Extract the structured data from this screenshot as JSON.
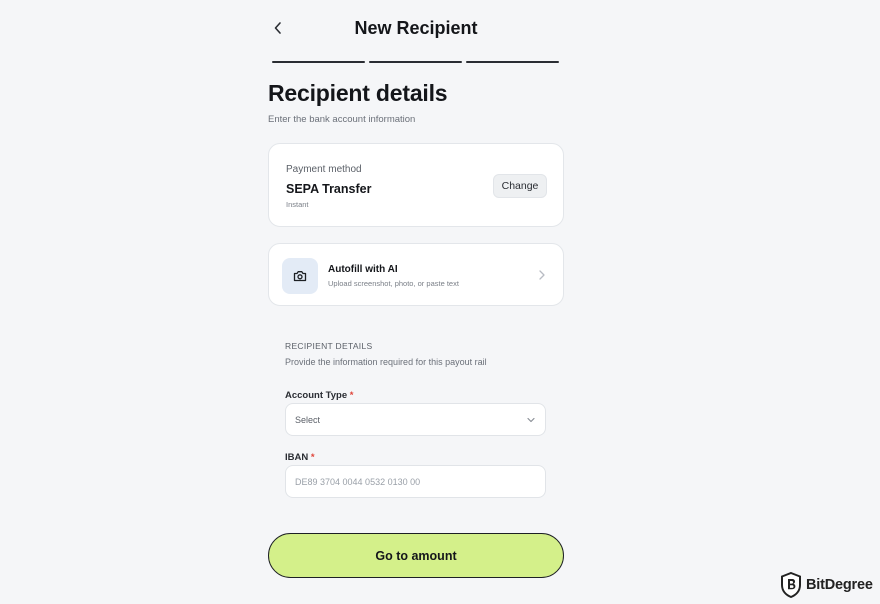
{
  "header": {
    "title": "New Recipient"
  },
  "stepper": {
    "total_steps": 3,
    "completed_steps": 3
  },
  "section": {
    "title": "Recipient details",
    "subtitle": "Enter the bank account information"
  },
  "payment_card": {
    "label": "Payment method",
    "method": "SEPA Transfer",
    "speed": "Instant",
    "change_label": "Change"
  },
  "autofill_card": {
    "title": "Autofill with AI",
    "subtitle": "Upload screenshot, photo, or paste text",
    "icon": "camera-icon"
  },
  "form": {
    "heading": "RECIPIENT DETAILS",
    "description": "Provide the information required for this payout rail",
    "account_type": {
      "label": "Account Type",
      "required_mark": "*",
      "value": "Select"
    },
    "iban": {
      "label": "IBAN",
      "required_mark": "*",
      "placeholder": "DE89 3704 0044 0532 0130 00"
    }
  },
  "cta": {
    "label": "Go to amount"
  },
  "watermark": {
    "text": "BitDegree"
  },
  "colors": {
    "background": "#f5f6f8",
    "accent": "#d4f08a",
    "required": "#e0453a",
    "icon_tile": "#e3ebf6"
  }
}
